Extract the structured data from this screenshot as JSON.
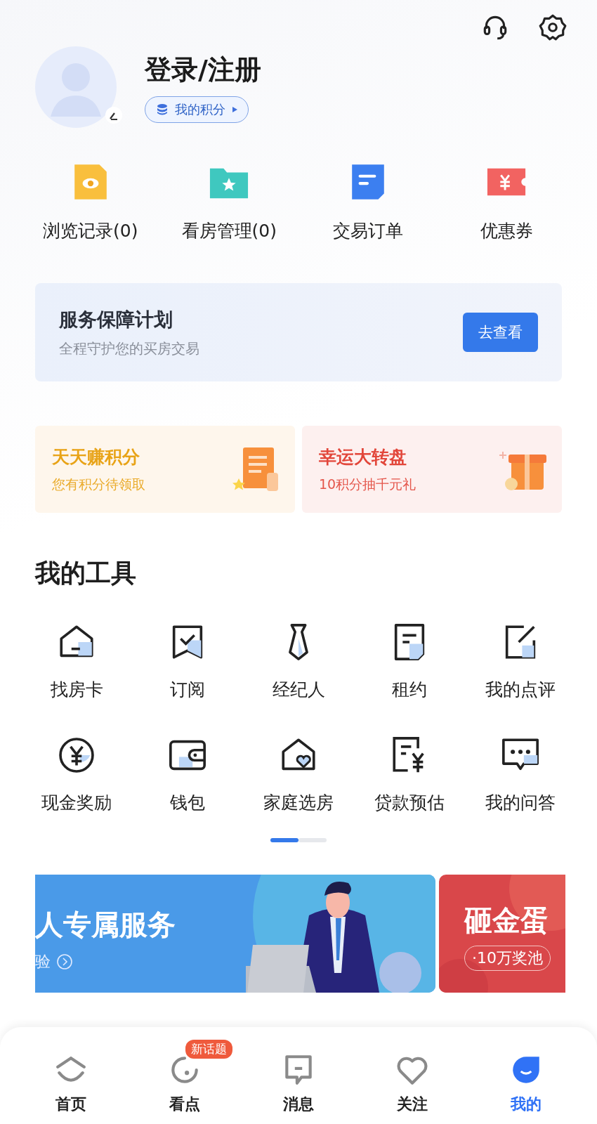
{
  "header": {
    "title": "登录/注册",
    "points_button": "我的积分"
  },
  "quick_links": [
    {
      "label": "浏览记录(0)",
      "kind": "eye"
    },
    {
      "label": "看房管理(0)",
      "kind": "folder"
    },
    {
      "label": "交易订单",
      "kind": "doc"
    },
    {
      "label": "优惠券",
      "kind": "coupon"
    }
  ],
  "service_card": {
    "title": "服务保障计划",
    "subtitle": "全程守护您的买房交易",
    "button": "去查看"
  },
  "promos": [
    {
      "title": "天天赚积分",
      "subtitle": "您有积分待领取",
      "kind": "note"
    },
    {
      "title": "幸运大转盘",
      "subtitle": "10积分抽千元礼",
      "kind": "gift"
    }
  ],
  "tools": {
    "title": "我的工具",
    "items": [
      {
        "label": "找房卡",
        "kind": "house"
      },
      {
        "label": "订阅",
        "kind": "bookmark"
      },
      {
        "label": "经纪人",
        "kind": "tie"
      },
      {
        "label": "租约",
        "kind": "contract"
      },
      {
        "label": "我的点评",
        "kind": "edit"
      },
      {
        "label": "现金奖励",
        "kind": "yen"
      },
      {
        "label": "钱包",
        "kind": "wallet"
      },
      {
        "label": "家庭选房",
        "kind": "homeheart"
      },
      {
        "label": "贷款预估",
        "kind": "loan"
      },
      {
        "label": "我的问答",
        "kind": "chat"
      }
    ],
    "pages": [
      {
        "selected": true
      },
      {
        "selected": false
      }
    ]
  },
  "banners": [
    {
      "title": "人专属服务",
      "subtitle": "验",
      "kind": "blue"
    },
    {
      "title": "砸金蛋",
      "subtitle": "·10万奖池",
      "kind": "red"
    }
  ],
  "nav": [
    {
      "label": "首页",
      "kind": "home",
      "selected": false
    },
    {
      "label": "看点",
      "kind": "dot",
      "selected": false,
      "badge": "新话题"
    },
    {
      "label": "消息",
      "kind": "msg",
      "selected": false
    },
    {
      "label": "关注",
      "kind": "heart",
      "selected": false
    },
    {
      "label": "我的",
      "kind": "me",
      "selected": true
    }
  ]
}
